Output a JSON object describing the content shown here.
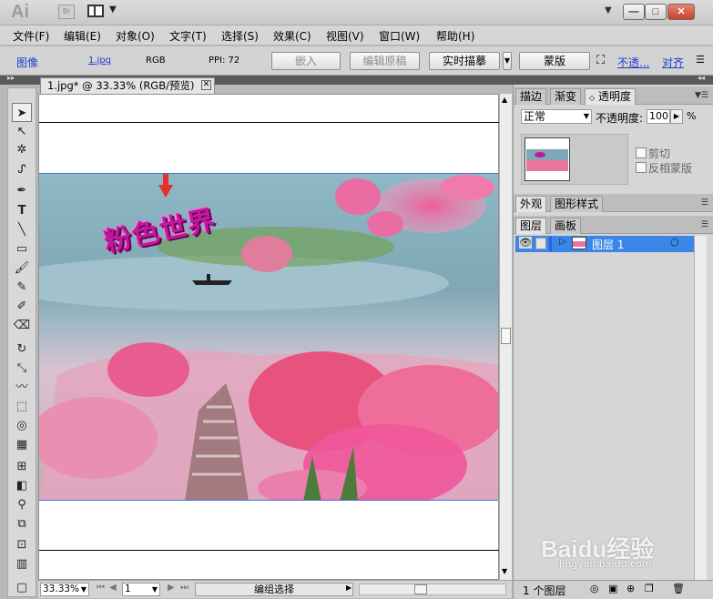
{
  "app": {
    "logo": "Ai",
    "bridge": "Br"
  },
  "window_controls": {
    "minimize": "—",
    "maximize": "□",
    "close": "✕"
  },
  "menu": [
    "文件(F)",
    "编辑(E)",
    "对象(O)",
    "文字(T)",
    "选择(S)",
    "效果(C)",
    "视图(V)",
    "窗口(W)",
    "帮助(H)"
  ],
  "control_bar": {
    "type_label": "图像",
    "filename": "1.jpg",
    "color_mode": "RGB",
    "ppi": "PPI: 72",
    "embed_button": "嵌入",
    "edit_original_button": "编辑原稿",
    "live_trace_button": "实时描摹",
    "mask_button": "蒙版",
    "opacity_link": "不透...",
    "align_link": "对齐"
  },
  "document": {
    "tab_title": "1.jpg* @ 33.33% (RGB/预览)",
    "artwork_text": "粉色世界"
  },
  "status_bar": {
    "zoom": "33.33%",
    "page": "1",
    "status_text": "编组选择"
  },
  "panels": {
    "transparency_tabs": [
      "描边",
      "渐变",
      "透明度"
    ],
    "blend_mode": "正常",
    "opacity_label": "不透明度:",
    "opacity_value": "100",
    "opacity_unit": "%",
    "clip_label": "剪切",
    "invert_mask_label": "反相蒙版",
    "appearance_tabs": [
      "外观",
      "图形样式"
    ],
    "layers_tabs": [
      "图层",
      "画板"
    ],
    "layer_name": "图层 1",
    "layers_count": "1 个图层"
  },
  "watermark": {
    "brand": "Baidu经验",
    "url": "jingyan.baidu.com"
  },
  "colors": {
    "selection_blue": "#3b86e6",
    "menu_bg": "#d6d6d6",
    "artwork_magenta": "#c2189e"
  }
}
